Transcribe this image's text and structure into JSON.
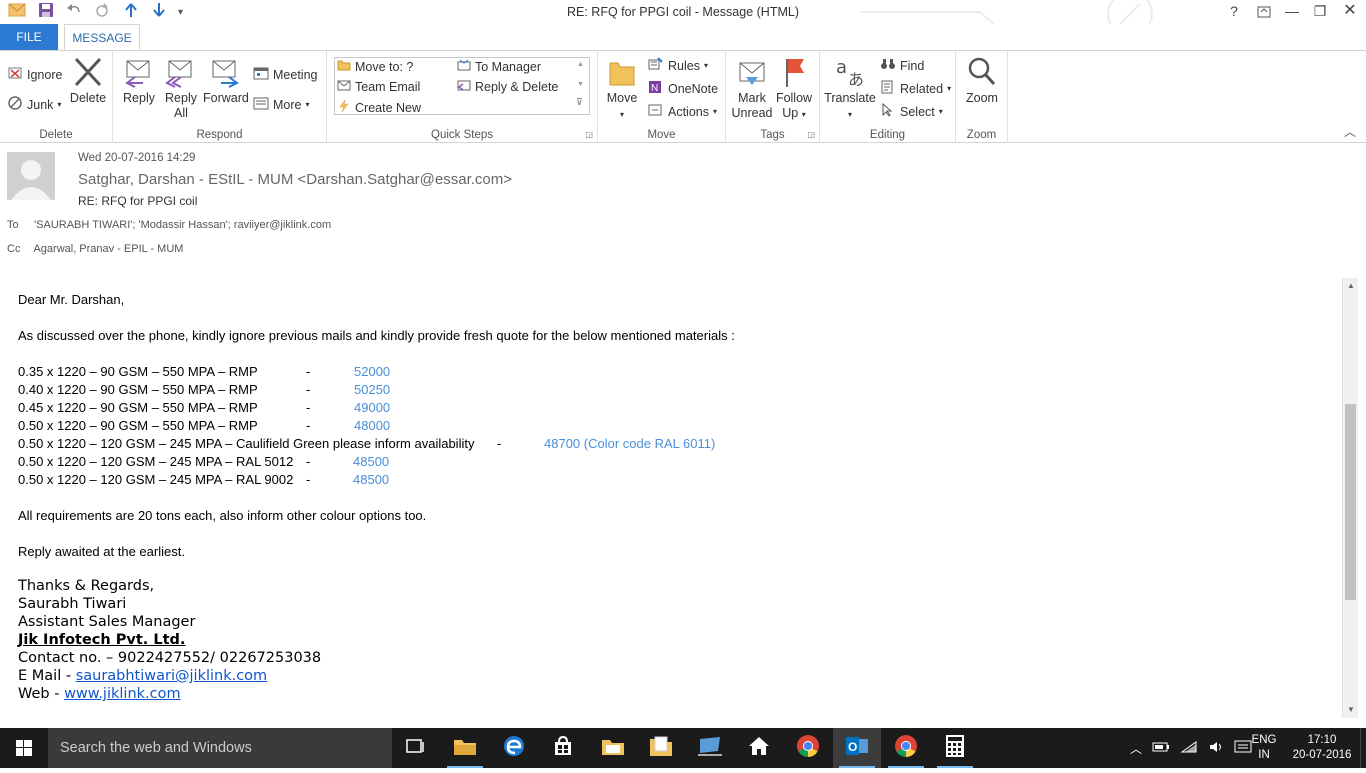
{
  "window": {
    "title": "RE: RFQ for PPGI coil - Message (HTML)"
  },
  "tabs": {
    "file": "FILE",
    "message": "MESSAGE"
  },
  "ribbon": {
    "delete_group": {
      "label": "Delete",
      "ignore": "Ignore",
      "junk": "Junk",
      "delete": "Delete"
    },
    "respond_group": {
      "label": "Respond",
      "reply": "Reply",
      "reply_all_1": "Reply",
      "reply_all_2": "All",
      "forward": "Forward",
      "meeting": "Meeting",
      "more": "More"
    },
    "quicksteps_group": {
      "label": "Quick Steps",
      "move_to": "Move to: ?",
      "team_email": "Team Email",
      "create_new": "Create New",
      "to_manager": "To Manager",
      "reply_delete": "Reply & Delete"
    },
    "move_group": {
      "label": "Move",
      "move": "Move",
      "rules": "Rules",
      "onenote": "OneNote",
      "actions": "Actions"
    },
    "tags_group": {
      "label": "Tags",
      "mark_unread_1": "Mark",
      "mark_unread_2": "Unread",
      "follow_up_1": "Follow",
      "follow_up_2": "Up"
    },
    "editing_group": {
      "label": "Editing",
      "translate": "Translate",
      "find": "Find",
      "related": "Related",
      "select": "Select"
    },
    "zoom_group": {
      "label": "Zoom",
      "zoom": "Zoom"
    }
  },
  "message": {
    "date": "Wed 20-07-2016 14:29",
    "from": "Satghar, Darshan - EStIL - MUM <Darshan.Satghar@essar.com>",
    "subject": "RE: RFQ for PPGI coil",
    "to_label": "To",
    "to": "'SAURABH TIWARI'; 'Modassir Hassan'; raviiyer@jiklink.com",
    "cc_label": "Cc",
    "cc": "Agarwal, Pranav - EPIL - MUM"
  },
  "body": {
    "greeting": "Dear Mr. Darshan,",
    "intro": "As discussed over the phone, kindly ignore previous mails and kindly provide fresh quote for the below mentioned materials :",
    "items": [
      {
        "spec": "0.35 x 1220 – 90 GSM – 550 MPA – RMP",
        "dash": "-",
        "price": "52000"
      },
      {
        "spec": "0.40 x 1220 – 90 GSM – 550 MPA – RMP",
        "dash": "-",
        "price": "50250"
      },
      {
        "spec": "0.45 x 1220 – 90 GSM – 550 MPA – RMP",
        "dash": "-",
        "price": "49000"
      },
      {
        "spec": "0.50 x 1220 – 90 GSM – 550 MPA – RMP",
        "dash": "-",
        "price": "48000"
      },
      {
        "spec": "0.50 x 1220 – 120 GSM – 245 MPA – Caulifield Green please inform availability",
        "dash": "-",
        "price": "48700 (Color code RAL 6011)"
      },
      {
        "spec": "0.50 x 1220 – 120 GSM – 245 MPA – RAL 5012",
        "dash": "-",
        "price": "48500"
      },
      {
        "spec": "0.50 x 1220 – 120 GSM – 245 MPA – RAL 9002",
        "dash": "-",
        "price": "48500"
      }
    ],
    "requirements": "All requirements are 20 tons each, also inform other colour options too.",
    "awaited": "Reply awaited at the earliest.",
    "signature": {
      "regards": "Thanks & Regards,",
      "name": "Saurabh Tiwari",
      "role": "Assistant Sales Manager",
      "company": "Jik Infotech Pvt. Ltd.",
      "contact": "Contact no. – 9022427552/ 02267253038",
      "email_label": "E Mail - ",
      "email": "saurabhtiwari@jiklink.com",
      "web_label": "Web - ",
      "web": "www.jiklink.com"
    }
  },
  "scrollbar": {
    "position_fraction": 0.52
  },
  "taskbar": {
    "search_placeholder": "Search the web and Windows",
    "lang_1": "ENG",
    "lang_2": "IN",
    "time": "17:10",
    "date": "20-07-2016"
  },
  "colors": {
    "accent": "#2b79d0",
    "price_blue": "#4a8fd8",
    "link": "#1155cc",
    "taskbar": "#1b1b1b"
  }
}
